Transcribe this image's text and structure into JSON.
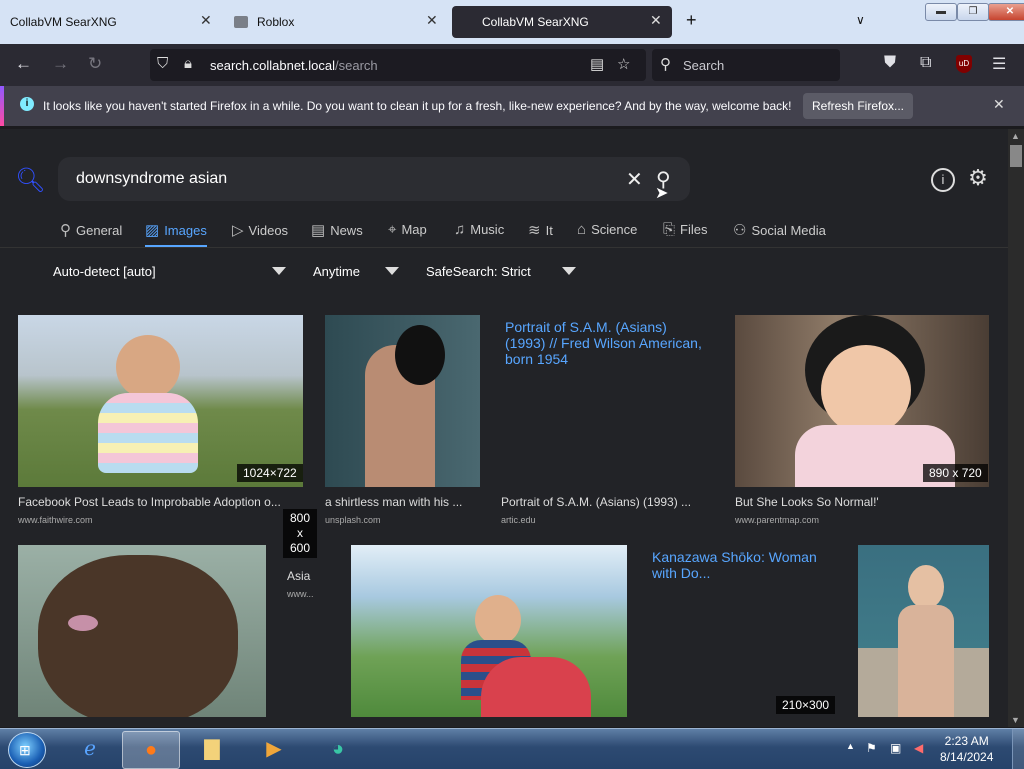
{
  "browser": {
    "tabs": [
      {
        "title": "CollabVM SearXNG",
        "active": false
      },
      {
        "title": "Roblox",
        "active": false
      },
      {
        "title": "CollabVM SearXNG",
        "active": true
      }
    ],
    "url_host": "search.collabnet.local",
    "url_path": "/search",
    "search_placeholder": "Search",
    "ublock_label": "uD",
    "notification": {
      "message": "It looks like you haven't started Firefox in a while. Do you want to clean it up for a fresh, like-new experience? And by the way, welcome back!",
      "button": "Refresh Firefox..."
    }
  },
  "search": {
    "query": "downsyndrome asian",
    "categories": [
      "General",
      "Images",
      "Videos",
      "News",
      "Map",
      "Music",
      "It",
      "Science",
      "Files",
      "Social Media"
    ],
    "active_category": "Images",
    "filters": {
      "language": "Auto-detect [auto]",
      "time": "Anytime",
      "safesearch": "SafeSearch: Strict"
    }
  },
  "results": [
    {
      "title": "Facebook Post Leads to Improbable Adoption o...",
      "url": "www.faithwire.com",
      "dims": "1024×722"
    },
    {
      "title": "a shirtless man with his ...",
      "url": "unsplash.com",
      "dims": ""
    },
    {
      "title": "Portrait of S.A.M. (Asians) (1993) ...",
      "url": "artic.edu",
      "dims": "",
      "placeholder": "Portrait of S.A.M. (Asians) (1993) // Fred Wilson American, born 1954"
    },
    {
      "title": "But She Looks So Normal!'",
      "url": "www.parentmap.com",
      "dims": "890 x 720"
    },
    {
      "title": "",
      "url": "",
      "dims": ""
    },
    {
      "title": "Asia",
      "url": "www...",
      "dims": "800 x 600"
    },
    {
      "title": "",
      "url": "",
      "dims": ""
    },
    {
      "title": "",
      "url": "",
      "dims": "210×300",
      "placeholder": "Kanazawa Shōko: Woman with Do..."
    },
    {
      "title": "",
      "url": "",
      "dims": ""
    }
  ],
  "taskbar": {
    "time": "2:23 AM",
    "date": "8/14/2024"
  },
  "colors": {
    "accent": "#58a6ff",
    "searx_logo": "#3050ff",
    "page_bg": "#222327"
  }
}
